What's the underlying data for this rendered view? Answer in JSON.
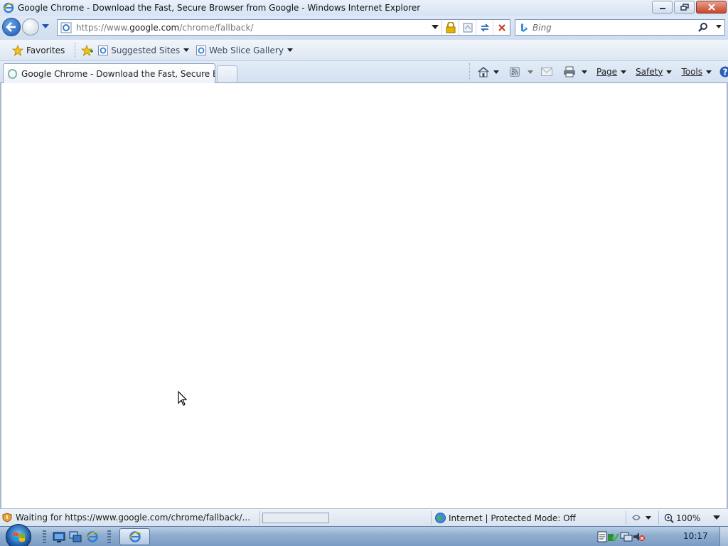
{
  "window": {
    "title": "Google Chrome - Download the Fast, Secure Browser from Google - Windows Internet Explorer"
  },
  "address": {
    "url_prefix": "https://www.",
    "url_domain": "google.com",
    "url_path": "/chrome/fallback/",
    "icons": [
      "page-icon",
      "dropdown-icon",
      "lock-icon",
      "compatibility-icon",
      "refresh-icon",
      "stop-icon"
    ]
  },
  "search": {
    "placeholder": "Bing"
  },
  "favorites": {
    "favorites_label": "Favorites",
    "items": [
      {
        "label": "Suggested Sites"
      },
      {
        "label": "Web Slice Gallery"
      }
    ]
  },
  "tabs": [
    {
      "label": "Google Chrome - Download the Fast, Secure Bro..."
    }
  ],
  "command_bar": {
    "page": "Page",
    "safety": "Safety",
    "tools": "Tools"
  },
  "status": {
    "text": "Waiting for https://www.google.com/chrome/fallback/...",
    "progress": 0.0,
    "zone": "Internet | Protected Mode: Off",
    "zoom": "100%"
  },
  "taskbar": {
    "clock": "10:17"
  },
  "colors": {
    "accent": "#1d57b8",
    "chrome_bg": "#dfe9f5",
    "close_button": "#c9462a"
  }
}
